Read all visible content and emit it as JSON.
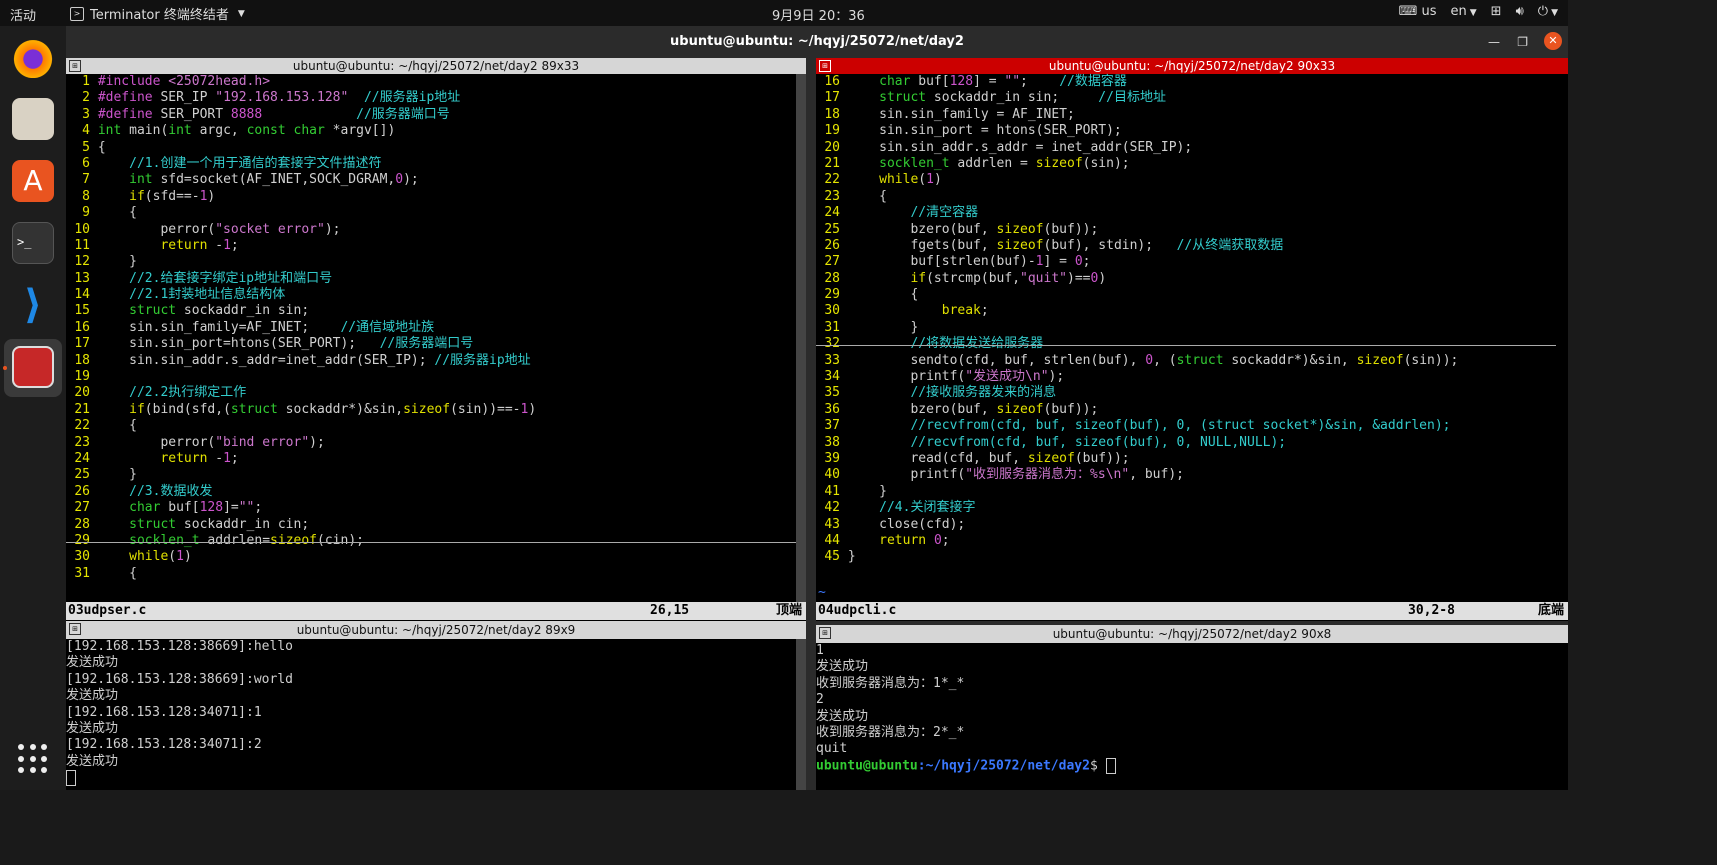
{
  "topbar": {
    "activities": "活动",
    "app_name": "Terminator 终端终结者",
    "clock": "9月9日  20：36",
    "keyboard": "us",
    "lang": "en"
  },
  "window": {
    "title": "ubuntu@ubuntu: ~/hqyj/25072/net/day2"
  },
  "panes": {
    "top_left_title": "ubuntu@ubuntu: ~/hqyj/25072/net/day2 89x33",
    "top_right_title": "ubuntu@ubuntu: ~/hqyj/25072/net/day2 90x33",
    "bottom_left_title": "ubuntu@ubuntu: ~/hqyj/25072/net/day2 89x9",
    "bottom_right_title": "ubuntu@ubuntu: ~/hqyj/25072/net/day2 90x8"
  },
  "editor_left": {
    "filename": "03udpser.c",
    "position": "26,15",
    "scroll": "顶端",
    "lines": [
      {
        "n": "1",
        "segs": [
          [
            "p",
            "#include "
          ],
          [
            "s",
            "<25072head.h>"
          ]
        ]
      },
      {
        "n": "2",
        "segs": [
          [
            "p",
            "#define "
          ],
          [
            "",
            "SER_IP "
          ],
          [
            "s",
            "\"192.168.153.128\""
          ],
          [
            "",
            "  "
          ],
          [
            "c",
            "//服务器ip地址"
          ]
        ]
      },
      {
        "n": "3",
        "segs": [
          [
            "p",
            "#define "
          ],
          [
            "",
            "SER_PORT "
          ],
          [
            "n",
            "8888"
          ],
          [
            "",
            "            "
          ],
          [
            "c",
            "//服务器端口号"
          ]
        ]
      },
      {
        "n": "4",
        "segs": [
          [
            "t",
            "int"
          ],
          [
            "",
            " main("
          ],
          [
            "t",
            "int"
          ],
          [
            "",
            " argc, "
          ],
          [
            "t",
            "const char"
          ],
          [
            "",
            " *argv[])"
          ]
        ]
      },
      {
        "n": "5",
        "segs": [
          [
            "",
            "{"
          ]
        ]
      },
      {
        "n": "6",
        "segs": [
          [
            "",
            "    "
          ],
          [
            "c",
            "//1.创建一个用于通信的套接字文件描述符"
          ]
        ]
      },
      {
        "n": "7",
        "segs": [
          [
            "",
            "    "
          ],
          [
            "t",
            "int"
          ],
          [
            "",
            " sfd=socket(AF_INET,SOCK_DGRAM,"
          ],
          [
            "n",
            "0"
          ],
          [
            "",
            ");"
          ]
        ]
      },
      {
        "n": "8",
        "segs": [
          [
            "",
            "    "
          ],
          [
            "k",
            "if"
          ],
          [
            "",
            "(sfd==-"
          ],
          [
            "n",
            "1"
          ],
          [
            "",
            ")"
          ]
        ]
      },
      {
        "n": "9",
        "segs": [
          [
            "",
            "    {"
          ]
        ]
      },
      {
        "n": "10",
        "segs": [
          [
            "",
            "        perror("
          ],
          [
            "s",
            "\"socket error\""
          ],
          [
            "",
            ");"
          ]
        ]
      },
      {
        "n": "11",
        "segs": [
          [
            "",
            "        "
          ],
          [
            "k",
            "return"
          ],
          [
            "",
            " -"
          ],
          [
            "n",
            "1"
          ],
          [
            "",
            ";"
          ]
        ]
      },
      {
        "n": "12",
        "segs": [
          [
            "",
            "    }"
          ]
        ]
      },
      {
        "n": "13",
        "segs": [
          [
            "",
            "    "
          ],
          [
            "c",
            "//2.给套接字绑定ip地址和端口号"
          ]
        ]
      },
      {
        "n": "14",
        "segs": [
          [
            "",
            "    "
          ],
          [
            "c",
            "//2.1封装地址信息结构体"
          ]
        ]
      },
      {
        "n": "15",
        "segs": [
          [
            "",
            "    "
          ],
          [
            "t",
            "struct"
          ],
          [
            "",
            " sockaddr_in sin;"
          ]
        ]
      },
      {
        "n": "16",
        "segs": [
          [
            "",
            "    sin.sin_family=AF_INET;    "
          ],
          [
            "c",
            "//通信域地址族"
          ]
        ]
      },
      {
        "n": "17",
        "segs": [
          [
            "",
            "    sin.sin_port=htons(SER_PORT);   "
          ],
          [
            "c",
            "//服务器端口号"
          ]
        ]
      },
      {
        "n": "18",
        "segs": [
          [
            "",
            "    sin.sin_addr.s_addr=inet_addr(SER_IP); "
          ],
          [
            "c",
            "//服务器ip地址"
          ]
        ]
      },
      {
        "n": "19",
        "segs": [
          [
            "",
            ""
          ]
        ]
      },
      {
        "n": "20",
        "segs": [
          [
            "",
            "    "
          ],
          [
            "c",
            "//2.2执行绑定工作"
          ]
        ]
      },
      {
        "n": "21",
        "segs": [
          [
            "",
            "    "
          ],
          [
            "k",
            "if"
          ],
          [
            "",
            "(bind(sfd,("
          ],
          [
            "t",
            "struct"
          ],
          [
            "",
            " sockaddr*)&sin,"
          ],
          [
            "k",
            "sizeof"
          ],
          [
            "",
            "(sin))==-"
          ],
          [
            "n",
            "1"
          ],
          [
            "",
            ")"
          ]
        ]
      },
      {
        "n": "22",
        "segs": [
          [
            "",
            "    {"
          ]
        ]
      },
      {
        "n": "23",
        "segs": [
          [
            "",
            "        perror("
          ],
          [
            "s",
            "\"bind error\""
          ],
          [
            "",
            ");"
          ]
        ]
      },
      {
        "n": "24",
        "segs": [
          [
            "",
            "        "
          ],
          [
            "k",
            "return"
          ],
          [
            "",
            " -"
          ],
          [
            "n",
            "1"
          ],
          [
            "",
            ";"
          ]
        ]
      },
      {
        "n": "25",
        "segs": [
          [
            "",
            "    }"
          ]
        ]
      },
      {
        "n": "26",
        "segs": [
          [
            "",
            "    "
          ],
          [
            "c",
            "//3.数据收发"
          ]
        ]
      },
      {
        "n": "27",
        "segs": [
          [
            "",
            "    "
          ],
          [
            "t",
            "char"
          ],
          [
            "",
            " buf["
          ],
          [
            "n",
            "128"
          ],
          [
            "",
            "]="
          ],
          [
            "s",
            "\"\""
          ],
          [
            "",
            ";"
          ]
        ]
      },
      {
        "n": "28",
        "segs": [
          [
            "",
            "    "
          ],
          [
            "t",
            "struct"
          ],
          [
            "",
            " sockaddr_in cin;"
          ]
        ]
      },
      {
        "n": "29",
        "segs": [
          [
            "",
            "    "
          ],
          [
            "t",
            "socklen_t"
          ],
          [
            "",
            " addrlen="
          ],
          [
            "k",
            "sizeof"
          ],
          [
            "",
            "(cin);"
          ]
        ]
      },
      {
        "n": "30",
        "segs": [
          [
            "",
            "    "
          ],
          [
            "k",
            "while"
          ],
          [
            "",
            "("
          ],
          [
            "n",
            "1"
          ],
          [
            "",
            ")"
          ]
        ]
      },
      {
        "n": "31",
        "segs": [
          [
            "",
            "    {"
          ]
        ]
      }
    ]
  },
  "editor_right": {
    "filename": "04udpcli.c",
    "position": "30,2-8",
    "scroll": "底端",
    "lines": [
      {
        "n": "16",
        "segs": [
          [
            "",
            "    "
          ],
          [
            "t",
            "char"
          ],
          [
            "",
            " buf["
          ],
          [
            "n",
            "128"
          ],
          [
            "",
            "] = "
          ],
          [
            "s",
            "\"\""
          ],
          [
            "",
            ";    "
          ],
          [
            "c",
            "//数据容器"
          ]
        ]
      },
      {
        "n": "17",
        "segs": [
          [
            "",
            "    "
          ],
          [
            "t",
            "struct"
          ],
          [
            "",
            " sockaddr_in sin;     "
          ],
          [
            "c",
            "//目标地址"
          ]
        ]
      },
      {
        "n": "18",
        "segs": [
          [
            "",
            "    sin.sin_family = AF_INET;"
          ]
        ]
      },
      {
        "n": "19",
        "segs": [
          [
            "",
            "    sin.sin_port = htons(SER_PORT);"
          ]
        ]
      },
      {
        "n": "20",
        "segs": [
          [
            "",
            "    sin.sin_addr.s_addr = inet_addr(SER_IP);"
          ]
        ]
      },
      {
        "n": "21",
        "segs": [
          [
            "",
            "    "
          ],
          [
            "t",
            "socklen_t"
          ],
          [
            "",
            " addrlen = "
          ],
          [
            "k",
            "sizeof"
          ],
          [
            "",
            "(sin);"
          ]
        ]
      },
      {
        "n": "22",
        "segs": [
          [
            "",
            "    "
          ],
          [
            "k",
            "while"
          ],
          [
            "",
            "("
          ],
          [
            "n",
            "1"
          ],
          [
            "",
            ")"
          ]
        ]
      },
      {
        "n": "23",
        "segs": [
          [
            "",
            "    {"
          ]
        ]
      },
      {
        "n": "24",
        "segs": [
          [
            "",
            "        "
          ],
          [
            "c",
            "//清空容器"
          ]
        ]
      },
      {
        "n": "25",
        "segs": [
          [
            "",
            "        bzero(buf, "
          ],
          [
            "k",
            "sizeof"
          ],
          [
            "",
            "(buf));"
          ]
        ]
      },
      {
        "n": "26",
        "segs": [
          [
            "",
            "        fgets(buf, "
          ],
          [
            "k",
            "sizeof"
          ],
          [
            "",
            "(buf), stdin);   "
          ],
          [
            "c",
            "//从终端获取数据"
          ]
        ]
      },
      {
        "n": "27",
        "segs": [
          [
            "",
            "        buf[strlen(buf)-"
          ],
          [
            "n",
            "1"
          ],
          [
            "",
            "] = "
          ],
          [
            "n",
            "0"
          ],
          [
            "",
            ";"
          ]
        ]
      },
      {
        "n": "28",
        "segs": [
          [
            "",
            "        "
          ],
          [
            "k",
            "if"
          ],
          [
            "",
            "(strcmp(buf,"
          ],
          [
            "s",
            "\"quit\""
          ],
          [
            "",
            ")=="
          ],
          [
            "n",
            "0"
          ],
          [
            "",
            ")"
          ]
        ]
      },
      {
        "n": "29",
        "segs": [
          [
            "",
            "        {"
          ]
        ]
      },
      {
        "n": "30",
        "segs": [
          [
            "",
            "            "
          ],
          [
            "k",
            "break"
          ],
          [
            "",
            ";"
          ]
        ]
      },
      {
        "n": "31",
        "segs": [
          [
            "",
            "        }"
          ]
        ]
      },
      {
        "n": "32",
        "segs": [
          [
            "",
            "        "
          ],
          [
            "c",
            "//将数据发送给服务器"
          ]
        ]
      },
      {
        "n": "33",
        "segs": [
          [
            "",
            "        sendto(cfd, buf, strlen(buf), "
          ],
          [
            "n",
            "0"
          ],
          [
            "",
            ", ("
          ],
          [
            "t",
            "struct"
          ],
          [
            "",
            " sockaddr*)&sin, "
          ],
          [
            "k",
            "sizeof"
          ],
          [
            "",
            "(sin));"
          ]
        ]
      },
      {
        "n": "34",
        "segs": [
          [
            "",
            "        printf("
          ],
          [
            "s",
            "\"发送成功\\n\""
          ],
          [
            "",
            ");"
          ]
        ]
      },
      {
        "n": "35",
        "segs": [
          [
            "",
            "        "
          ],
          [
            "c",
            "//接收服务器发来的消息"
          ]
        ]
      },
      {
        "n": "36",
        "segs": [
          [
            "",
            "        bzero(buf, "
          ],
          [
            "k",
            "sizeof"
          ],
          [
            "",
            "(buf));"
          ]
        ]
      },
      {
        "n": "37",
        "segs": [
          [
            "",
            "        "
          ],
          [
            "c",
            "//recvfrom(cfd, buf, sizeof(buf), 0, (struct socket*)&sin, &addrlen);"
          ]
        ]
      },
      {
        "n": "38",
        "segs": [
          [
            "",
            "        "
          ],
          [
            "c",
            "//recvfrom(cfd, buf, sizeof(buf), 0, NULL,NULL);"
          ]
        ]
      },
      {
        "n": "39",
        "segs": [
          [
            "",
            "        read(cfd, buf, "
          ],
          [
            "k",
            "sizeof"
          ],
          [
            "",
            "(buf));"
          ]
        ]
      },
      {
        "n": "40",
        "segs": [
          [
            "",
            "        printf("
          ],
          [
            "s",
            "\"收到服务器消息为：%s\\n\""
          ],
          [
            "",
            ", buf);"
          ]
        ]
      },
      {
        "n": "41",
        "segs": [
          [
            "",
            "    }"
          ]
        ]
      },
      {
        "n": "42",
        "segs": [
          [
            "",
            "    "
          ],
          [
            "c",
            "//4.关闭套接字"
          ]
        ]
      },
      {
        "n": "43",
        "segs": [
          [
            "",
            "    close(cfd);"
          ]
        ]
      },
      {
        "n": "44",
        "segs": [
          [
            "",
            "    "
          ],
          [
            "k",
            "return"
          ],
          [
            "",
            " "
          ],
          [
            "n",
            "0"
          ],
          [
            "",
            ";"
          ]
        ]
      },
      {
        "n": "45",
        "segs": [
          [
            "",
            "}"
          ]
        ]
      }
    ]
  },
  "terminal_left": {
    "lines": [
      "[192.168.153.128:38669]:hello",
      "发送成功",
      "[192.168.153.128:38669]:world",
      "发送成功",
      "[192.168.153.128:34071]:1",
      "发送成功",
      "[192.168.153.128:34071]:2",
      "发送成功"
    ]
  },
  "terminal_right": {
    "lines": [
      "1",
      "发送成功",
      "收到服务器消息为：1*_*",
      "2",
      "发送成功",
      "收到服务器消息为：2*_*",
      "quit"
    ],
    "prompt_user": "ubuntu@ubuntu",
    "prompt_path": ":~/hqyj/25072/net/day2",
    "prompt_sym": "$ "
  },
  "colors": {
    "active_pane": "#cc0000",
    "ubuntu_orange": "#e95420"
  }
}
